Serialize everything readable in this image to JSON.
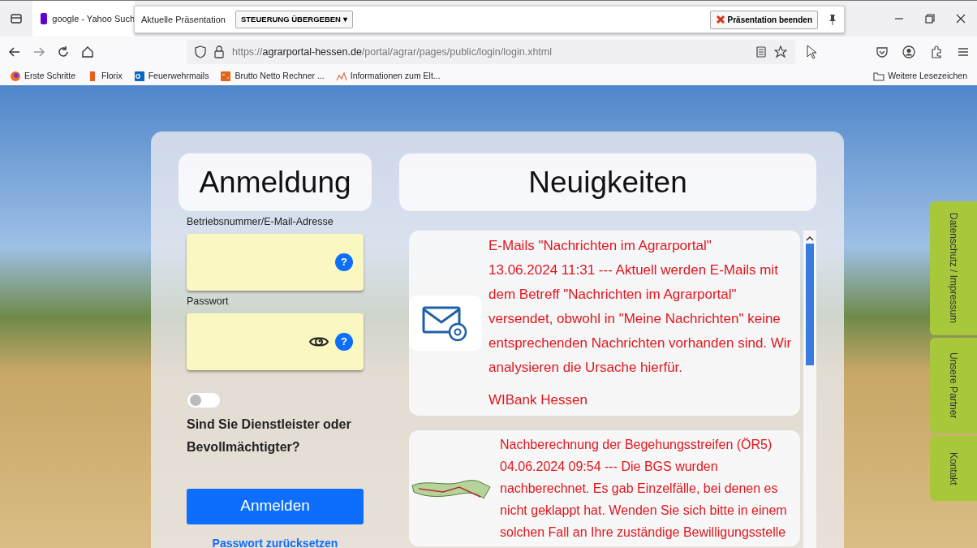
{
  "browser": {
    "tabs": [
      {
        "title": "google - Yahoo Such",
        "selected": true
      }
    ],
    "presentation_bar": {
      "label": "Aktuelle Präsentation",
      "control_button": "STEUERUNG ÜBERGEBEN",
      "control_caret": "▾",
      "end_button": "Präsentation beenden"
    },
    "url": "https://**agrarportal-hessen.de**/portal/agrar/pages/public/login/login.xhtml",
    "bookmarks": [
      {
        "label": "Erste Schritte",
        "kind": "firefox"
      },
      {
        "label": "Florix",
        "kind": "bar"
      },
      {
        "label": "Feuerwehrmails",
        "kind": "outlook"
      },
      {
        "label": "Brutto Netto Rechner ...",
        "kind": "calc"
      },
      {
        "label": "Informationen zum Elt...",
        "kind": "chart"
      }
    ],
    "other_bookmarks": "Weitere Lesezeichen"
  },
  "login": {
    "heading": "Anmeldung",
    "fields": [
      {
        "label": "Betriebsnummer/E-Mail-Adresse",
        "kind": "text",
        "help": "?"
      },
      {
        "label": "Passwort",
        "kind": "password",
        "help": "?"
      }
    ],
    "toggle": {
      "label": "Sind Sie Dienstleister oder Bevollmächtigter?",
      "on": false
    },
    "submit": "Anmelden",
    "reset_link": "Passwort zurücksetzen"
  },
  "news": {
    "heading": "Neuigkeiten",
    "items": [
      {
        "kind": "mail",
        "title": "E-Mails \"Nachrichten im Agrarportal\"",
        "text": "13.06.2024 11:31 --- Aktuell werden E-Mails mit dem Betreff \"Nachrichten im Agrarportal\" versendet, obwohl in \"Meine Nachrichten\" keine entsprechenden Nachrichten vorhanden sind. Wir analysieren die Ursache hierfür.",
        "source": "WIBank Hessen"
      },
      {
        "kind": "map",
        "title": "Nachberechnung der Begehungsstreifen (ÖR5)",
        "text": "04.06.2024 09:54 --- Die BGS wurden nachberechnet. Es gab Einzelfälle, bei denen es nicht geklappt hat. Wenden Sie sich bitte in einem solchen Fall an Ihre zuständige Bewilligungsstelle"
      }
    ]
  },
  "side_tabs": [
    "Datenschutz / Impressum",
    "Unsere Partner",
    "Kontakt"
  ]
}
